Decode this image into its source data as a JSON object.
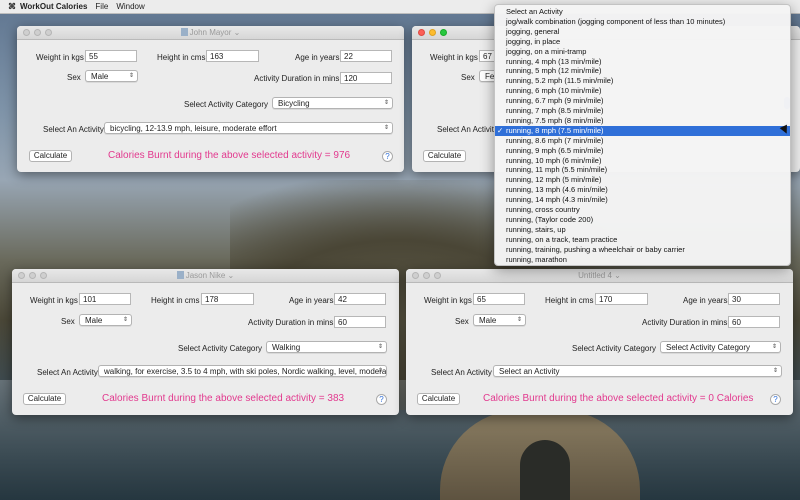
{
  "menubar": {
    "items": [
      "WorkOut Calories",
      "File",
      "Window"
    ]
  },
  "labels": {
    "weight": "Weight in kgs",
    "height": "Height in cms",
    "age": "Age in years",
    "sex": "Sex",
    "duration": "Activity Duration in mins",
    "category": "Select Activity Category",
    "activity": "Select An Activity",
    "calculate": "Calculate",
    "help": "?"
  },
  "windows": [
    {
      "title": "John Mayor",
      "weight": "55",
      "height": "163",
      "age": "22",
      "sex": "Male",
      "duration": "120",
      "category": "Bicycling",
      "activity": "bicycling, 12-13.9 mph, leisure, moderate effort",
      "result": "Calories Burnt during the above selected activity = 976"
    },
    {
      "title": "",
      "weight": "67",
      "sex": "Fe",
      "result": ""
    },
    {
      "title": "Jason Nike",
      "weight": "101",
      "height": "178",
      "age": "42",
      "sex": "Male",
      "duration": "60",
      "category": "Walking",
      "activity": "walking, for exercise, 3.5 to 4 mph, with ski poles, Nordic walking, level, moderate...",
      "result": "Calories Burnt during the above selected activity = 383"
    },
    {
      "title": "Untitled 4",
      "weight": "65",
      "height": "170",
      "age": "30",
      "sex": "Male",
      "duration": "60",
      "category": "Select Activity Category",
      "activity": "Select an Activity",
      "result": "Calories Burnt during the above selected activity = 0 Calories"
    }
  ],
  "dropdown": {
    "selected_index": 12,
    "items": [
      "Select an Activity",
      "jog/walk combination (jogging component of less than 10 minutes)",
      "jogging, general",
      "jogging, in place",
      "jogging, on a mini-tramp",
      "running, 4 mph (13 min/mile)",
      "running, 5 mph (12 min/mile)",
      "running, 5.2 mph (11.5 min/mile)",
      "running, 6 mph (10 min/mile)",
      "running, 6.7 mph (9 min/mile)",
      "running, 7 mph (8.5 min/mile)",
      "running, 7.5 mph (8 min/mile)",
      "running, 8 mph (7.5 min/mile)",
      "running, 8.6 mph (7 min/mile)",
      "running, 9 mph (6.5 min/mile)",
      "running, 10 mph (6 min/mile)",
      "running, 11 mph (5.5 min/mile)",
      "running, 12 mph (5 min/mile)",
      "running, 13 mph (4.6 min/mile)",
      "running, 14 mph (4.3 min/mile)",
      "running, cross country",
      "running, (Taylor code 200)",
      "running, stairs, up",
      "running, on a track, team practice",
      "running, training, pushing a wheelchair or baby carrier",
      "running, marathon"
    ]
  }
}
